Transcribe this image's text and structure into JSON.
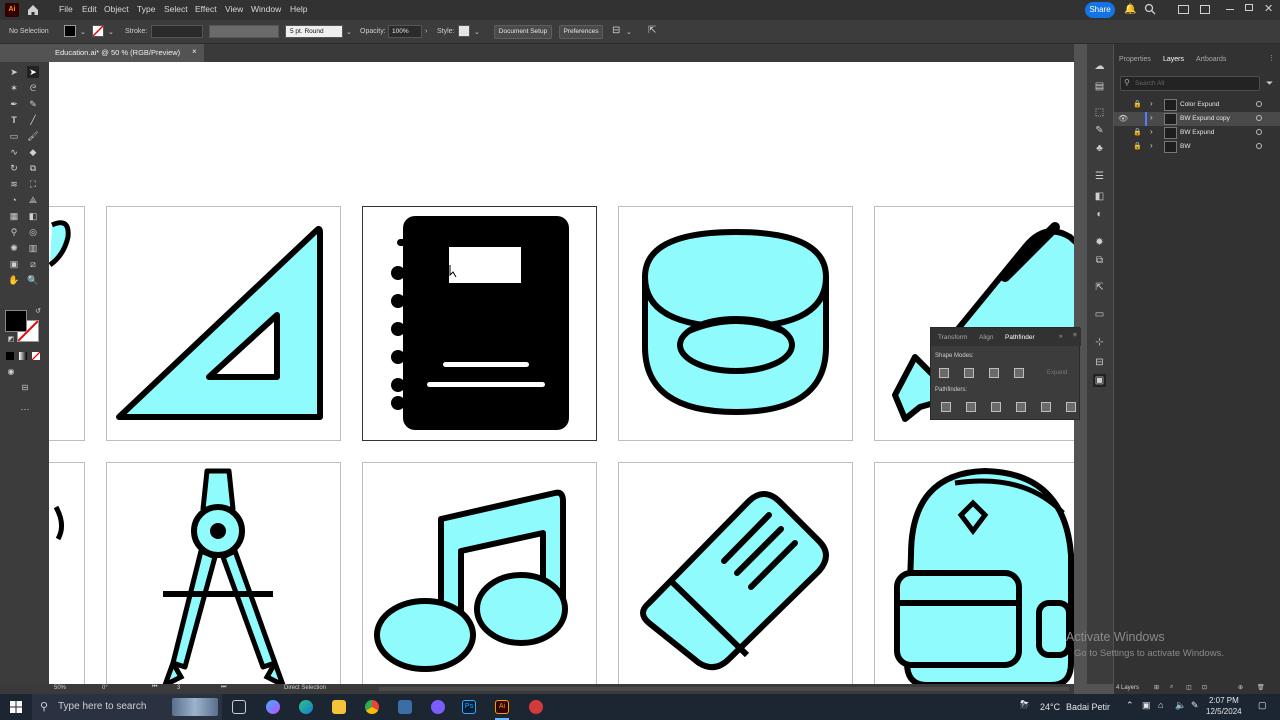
{
  "app": {
    "logo": "Ai",
    "menu": [
      "File",
      "Edit",
      "Object",
      "Type",
      "Select",
      "Effect",
      "View",
      "Window",
      "Help"
    ],
    "share_label": "Share"
  },
  "controlbar": {
    "selection_status": "No Selection",
    "stroke_label": "Stroke:",
    "brush_label": "5 pt. Round",
    "opacity_label": "Opacity:",
    "opacity_value": "100%",
    "style_label": "Style:",
    "document_setup": "Document Setup",
    "preferences": "Preferences"
  },
  "document": {
    "tab_title": "Education.ai* @ 50 % (RGB/Preview)"
  },
  "colors": {
    "icon_fill": "#8ffbfc",
    "icon_stroke": "#000000",
    "accent": "#1473e6"
  },
  "layers_panel": {
    "tabs": [
      "Properties",
      "Layers",
      "Artboards"
    ],
    "active_tab": "Layers",
    "search_placeholder": "Search All",
    "layers": [
      {
        "name": "Color Expund",
        "visible": false,
        "locked": true,
        "selected": false
      },
      {
        "name": "BW Expund copy",
        "visible": true,
        "locked": false,
        "selected": true
      },
      {
        "name": "BW Expund",
        "visible": false,
        "locked": true,
        "selected": false
      },
      {
        "name": "BW",
        "visible": false,
        "locked": true,
        "selected": false
      }
    ],
    "layer_count": "4 Layers"
  },
  "pathfinder": {
    "tabs": [
      "Transform",
      "Align",
      "Pathfinder"
    ],
    "active_tab": "Pathfinder",
    "shape_modes_label": "Shape Modes:",
    "pathfinders_label": "Pathfinders:",
    "expand_label": "Expand"
  },
  "statusbar": {
    "zoom": "50%",
    "rotation": "0°",
    "artboard_number": "3",
    "tool_status": "Direct Selection"
  },
  "watermark": {
    "line1": "Activate Windows",
    "line2": "Go to Settings to activate Windows."
  },
  "taskbar": {
    "search_placeholder": "Type here to search",
    "weather_temp": "24°C",
    "weather_text": "Badai Petir",
    "time": "2:07 PM",
    "date": "12/5/2024"
  }
}
